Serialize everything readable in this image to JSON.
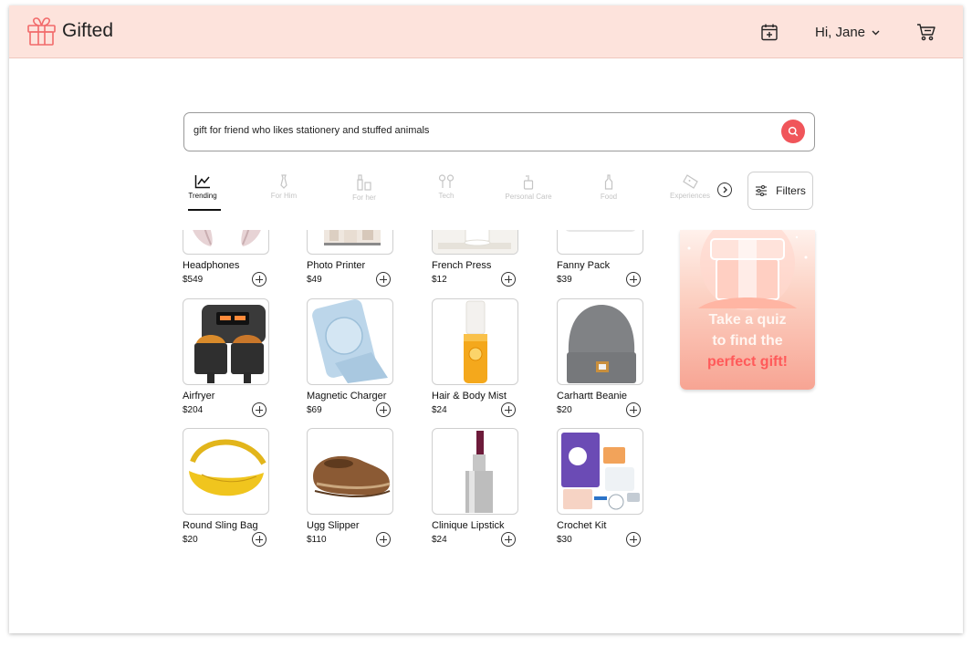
{
  "app": {
    "name": "Gifted"
  },
  "header": {
    "greeting": "Hi, Jane"
  },
  "search": {
    "query": "gift for friend who likes stationery and stuffed animals"
  },
  "categories": [
    {
      "label": "Trending",
      "icon": "trending-chart-icon",
      "active": true
    },
    {
      "label": "For Him",
      "icon": "tie-icon",
      "active": false
    },
    {
      "label": "For her",
      "icon": "cosmetics-icon",
      "active": false
    },
    {
      "label": "Tech",
      "icon": "earbuds-icon",
      "active": false
    },
    {
      "label": "Personal Care",
      "icon": "soap-bottle-icon",
      "active": false
    },
    {
      "label": "Food",
      "icon": "bottle-icon",
      "active": false
    },
    {
      "label": "Experiences",
      "icon": "ticket-icon",
      "active": false
    }
  ],
  "filters": {
    "label": "Filters"
  },
  "products": [
    {
      "name": "Headphones",
      "price": "$549"
    },
    {
      "name": "Photo Printer",
      "price": "$49"
    },
    {
      "name": "French Press",
      "price": "$12"
    },
    {
      "name": "Fanny Pack",
      "price": "$39"
    },
    {
      "name": "Airfryer",
      "price": "$204"
    },
    {
      "name": "Magnetic Charger",
      "price": "$69"
    },
    {
      "name": "Hair & Body Mist",
      "price": "$24"
    },
    {
      "name": "Carhartt Beanie",
      "price": "$20"
    },
    {
      "name": "Round Sling Bag",
      "price": "$20"
    },
    {
      "name": "Ugg Slipper",
      "price": "$110"
    },
    {
      "name": "Clinique Lipstick",
      "price": "$24"
    },
    {
      "name": "Crochet Kit",
      "price": "$30"
    }
  ],
  "quiz": {
    "line1": "Take a quiz",
    "line2": "to find the",
    "line3": "perfect gift!"
  },
  "colors": {
    "header_bg": "#fde3dc",
    "accent": "#f0555a",
    "quiz_highlight": "#ff5a5a"
  }
}
